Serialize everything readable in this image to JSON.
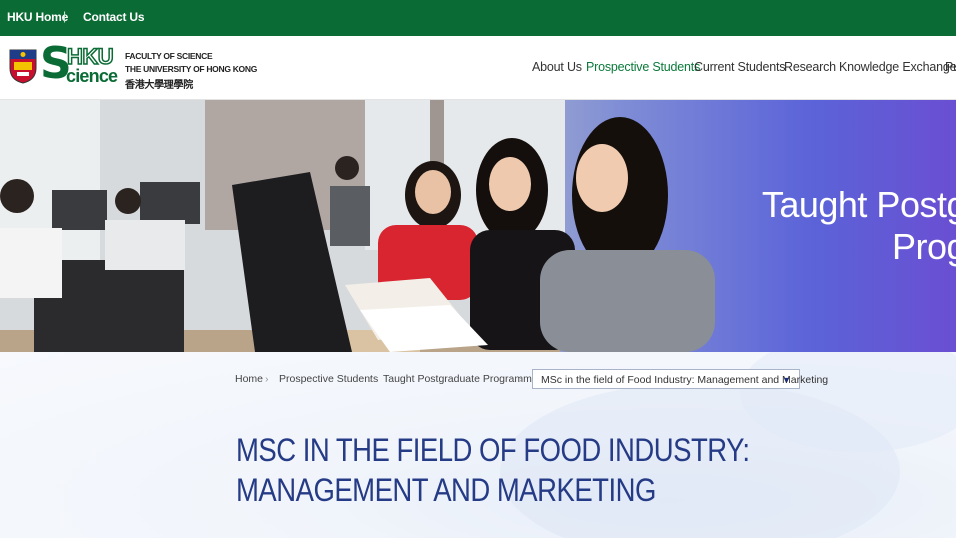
{
  "topbar": {
    "home_label": "HKU Home",
    "separator": "|",
    "contact_label": "Contact Us",
    "bg_color": "#0b6b35"
  },
  "logo": {
    "s_letter": "S",
    "hku": "HKU",
    "science": "cience",
    "line1": "FACULTY OF SCIENCE",
    "line2": "THE UNIVERSITY OF HONG KONG",
    "line3": "香港大學理學院",
    "crest_icon": "hku-crest-icon"
  },
  "nav": {
    "items": [
      {
        "label": "About Us"
      },
      {
        "label": "Prospective Students",
        "active": true
      },
      {
        "label": "Current Students"
      },
      {
        "label": "Research"
      },
      {
        "label": "Knowledge Exchange"
      },
      {
        "label": "Pu"
      }
    ],
    "active_color": "#0b7a3b"
  },
  "hero": {
    "title_line1": "Taught Postg",
    "title_line2": "Prog"
  },
  "breadcrumb": {
    "items": [
      "Home",
      "Prospective Students",
      "Taught Postgraduate Programme"
    ],
    "current": "MSc in the field of Food Industry: Management and Marketing",
    "caret_icon": "caret-down-icon"
  },
  "page": {
    "title": "MSC IN THE FIELD OF FOOD INDUSTRY: MANAGEMENT AND MARKETING",
    "title_color": "#263b86"
  }
}
